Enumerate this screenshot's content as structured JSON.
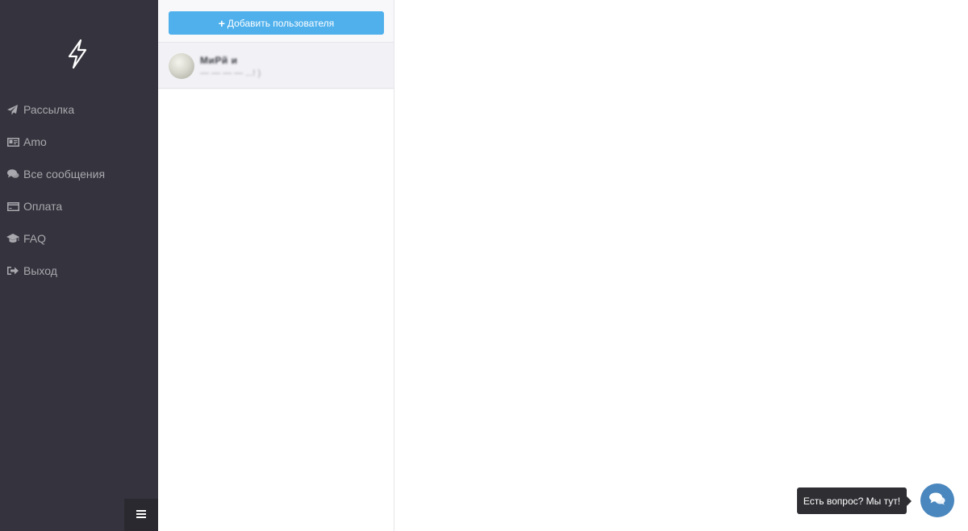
{
  "sidebar": {
    "logo_icon": "lightning-bolt-icon",
    "items": [
      {
        "label": "Рассылка",
        "icon": "paper-plane-icon"
      },
      {
        "label": "Amo",
        "icon": "id-card-icon"
      },
      {
        "label": "Все сообщения",
        "icon": "comments-icon"
      },
      {
        "label": "Оплата",
        "icon": "credit-card-icon"
      },
      {
        "label": "FAQ",
        "icon": "graduation-cap-icon"
      },
      {
        "label": "Выход",
        "icon": "sign-out-icon"
      }
    ],
    "toggle_icon": "hamburger-icon"
  },
  "users": {
    "add_button_label": "Добавить пользователя",
    "add_button_icon": "plus-icon",
    "list": [
      {
        "name": "МиРй и",
        "subtitle": "— — — — ...! )"
      }
    ]
  },
  "chat_widget": {
    "tooltip": "Есть вопрос? Мы тут!",
    "icon": "chat-bubbles-icon"
  },
  "colors": {
    "sidebar_bg": "#35333d",
    "accent": "#4fb0ec",
    "chat_button": "#4a87be"
  }
}
